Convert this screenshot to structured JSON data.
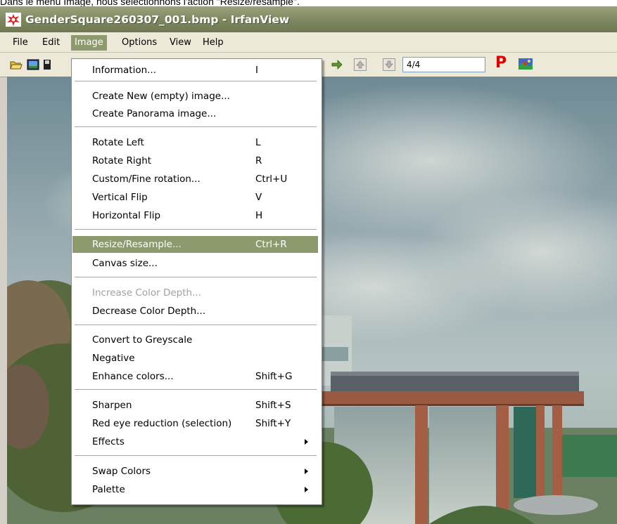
{
  "caption": "Dans le menu Image, nous sélectionnons l'action \"Resize/resample\".",
  "window": {
    "title": "GenderSquare260307_001.bmp - IrfanView"
  },
  "menubar": {
    "items": [
      "File",
      "Edit",
      "Image",
      "Options",
      "View",
      "Help"
    ],
    "active": "Image"
  },
  "toolbar": {
    "icons": [
      "open-icon",
      "thumbnails-icon",
      "save-icon",
      "next-arrow-icon",
      "scroll-up-icon",
      "scroll-down-icon",
      "paint-icon"
    ],
    "page_indicator": "4/4",
    "p_button": "P"
  },
  "image_menu": {
    "items": [
      {
        "label": "Information...",
        "shortcut": "I"
      },
      {
        "label": "Create New (empty) image...",
        "shortcut": ""
      },
      {
        "label": "Create Panorama image...",
        "shortcut": ""
      },
      {
        "label": "Rotate Left",
        "shortcut": "L"
      },
      {
        "label": "Rotate Right",
        "shortcut": "R"
      },
      {
        "label": "Custom/Fine rotation...",
        "shortcut": "Ctrl+U"
      },
      {
        "label": "Vertical Flip",
        "shortcut": "V"
      },
      {
        "label": "Horizontal Flip",
        "shortcut": "H"
      },
      {
        "label": "Resize/Resample...",
        "shortcut": "Ctrl+R",
        "highlighted": true
      },
      {
        "label": "Canvas size...",
        "shortcut": ""
      },
      {
        "label": "Increase Color Depth...",
        "shortcut": "",
        "disabled": true
      },
      {
        "label": "Decrease Color Depth...",
        "shortcut": ""
      },
      {
        "label": "Convert to Greyscale",
        "shortcut": ""
      },
      {
        "label": "Negative",
        "shortcut": ""
      },
      {
        "label": "Enhance colors...",
        "shortcut": "Shift+G"
      },
      {
        "label": "Sharpen",
        "shortcut": "Shift+S"
      },
      {
        "label": "Red eye reduction (selection)",
        "shortcut": "Shift+Y"
      },
      {
        "label": "Effects",
        "shortcut": "",
        "submenu": true
      },
      {
        "label": "Swap Colors",
        "shortcut": "",
        "submenu": true
      },
      {
        "label": "Palette",
        "shortcut": "",
        "submenu": true
      }
    ]
  },
  "colors": {
    "titlebar": "#7d875e",
    "menu_highlight": "#8c9a6e",
    "menubar": "#ece9d8",
    "disabled_text": "#a0a0a0"
  }
}
